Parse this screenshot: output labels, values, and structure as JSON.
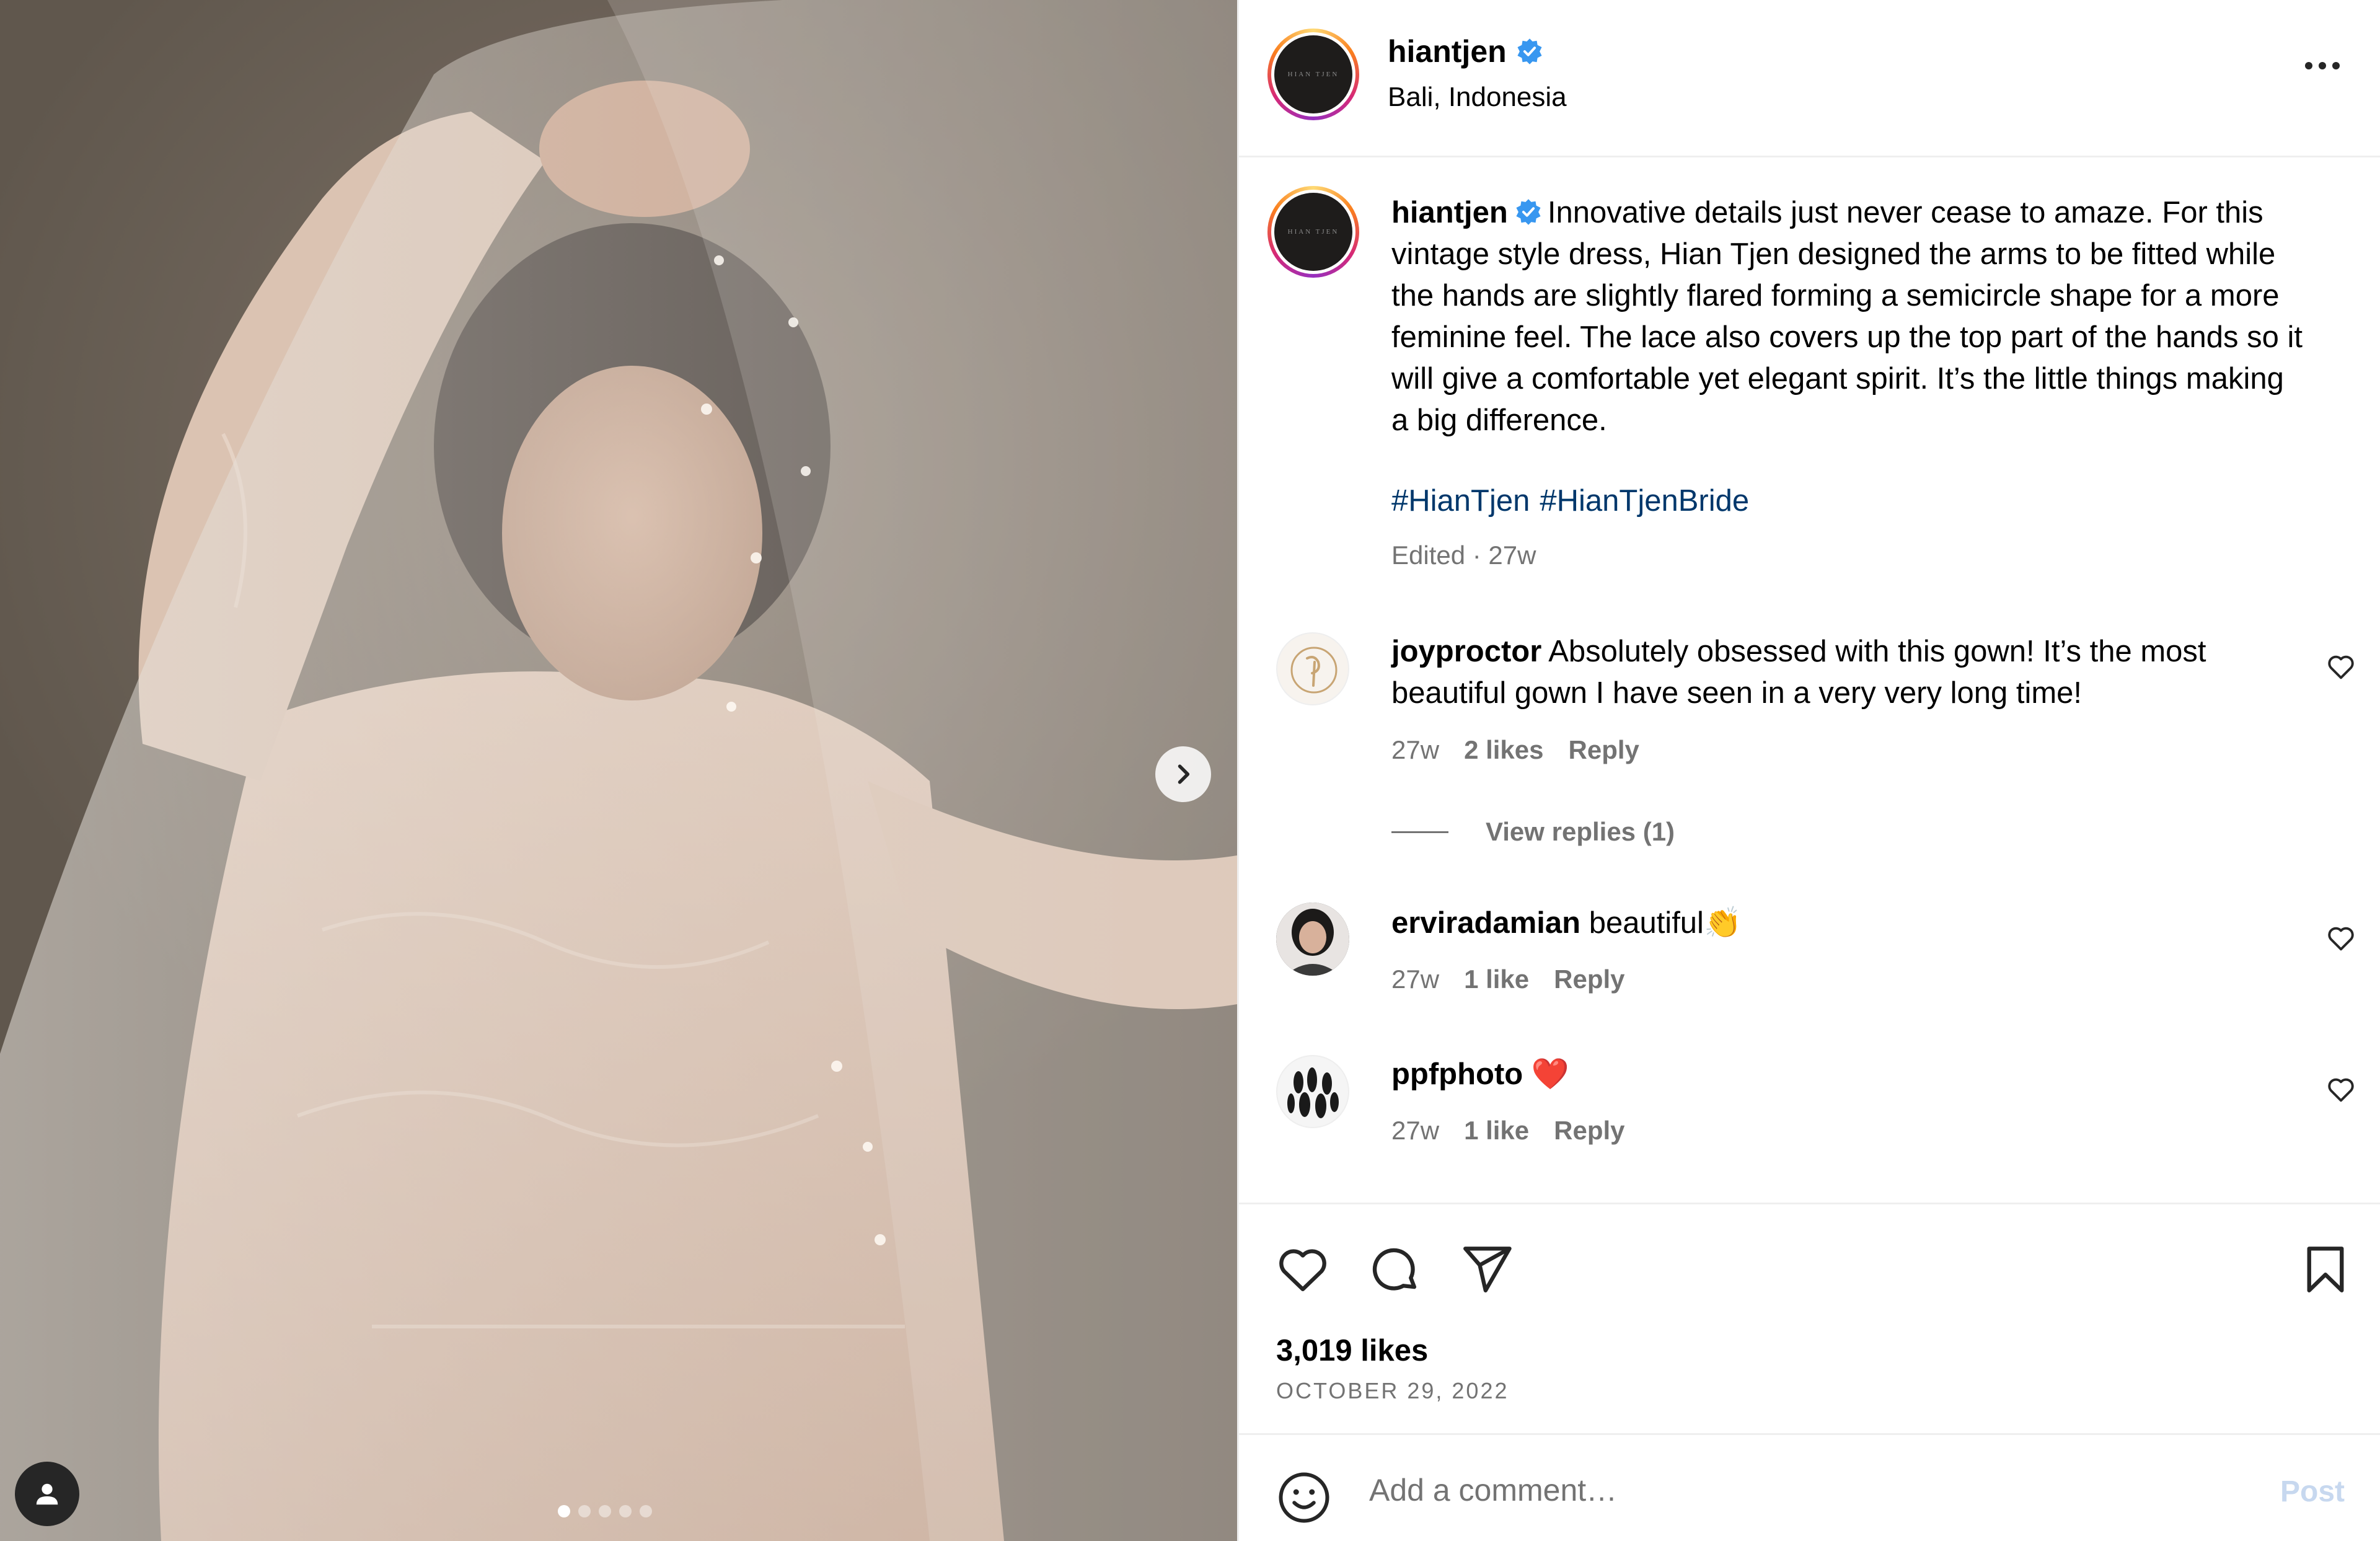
{
  "post": {
    "username": "hiantjen",
    "location": "Bali, Indonesia",
    "avatar_text": "HIAN TJEN",
    "caption": "Innovative details just never cease to amaze. For this vintage style dress, Hian Tjen designed the arms to be fitted while the hands are slightly flared forming a semicircle shape for a more feminine feel. The lace also covers up the top part of the hands so it will give a comfortable yet elegant spirit. It’s the little things making a big difference.",
    "hashtags": [
      "#HianTjen",
      "#HianTjenBride"
    ],
    "caption_meta": "Edited · 27w"
  },
  "comments": [
    {
      "username": "joyproctor",
      "text": "Absolutely obsessed with this gown! It’s the most beautiful gown I have seen in a very very long time!",
      "age": "27w",
      "likes": "2 likes",
      "reply": "Reply",
      "view_replies": "View replies (1)"
    },
    {
      "username": "erviradamian",
      "text": "beautiful👏",
      "age": "27w",
      "likes": "1 like",
      "reply": "Reply"
    },
    {
      "username": "ppfphoto",
      "text": "❤️",
      "age": "27w",
      "likes": "1 like",
      "reply": "Reply"
    }
  ],
  "stats": {
    "likes": "3,019 likes",
    "date": "OCTOBER 29, 2022"
  },
  "composer": {
    "placeholder": "Add a comment…",
    "post_label": "Post"
  },
  "carousel": {
    "slide_count": 5,
    "active_index": 0
  },
  "icons": {
    "verified": "verified-badge-icon",
    "more": "more-options-icon",
    "like": "heart-icon",
    "comment": "comment-icon",
    "share": "share-icon",
    "save": "bookmark-icon",
    "emoji": "emoji-icon",
    "next": "chevron-right-icon",
    "tag": "user-tag-icon"
  },
  "colors": {
    "verified": "#3897f0",
    "link": "#00376b",
    "muted": "#737373",
    "post_disabled": "#c7d8ef"
  }
}
